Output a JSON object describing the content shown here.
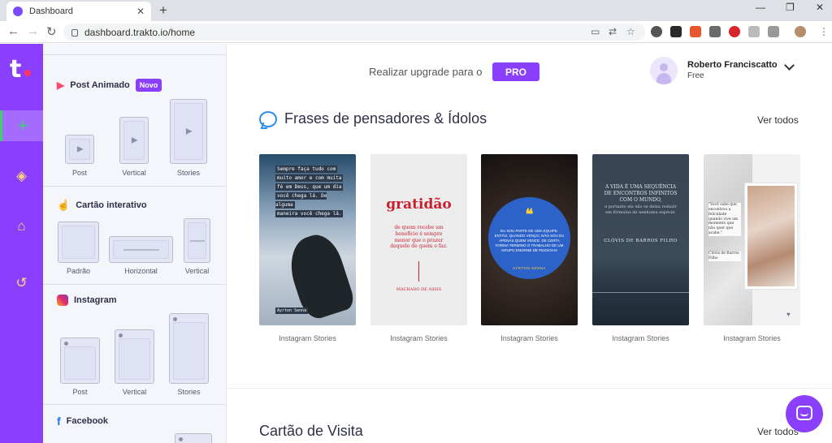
{
  "browser": {
    "tab_title": "Dashboard",
    "url": "dashboard.trakto.io/home",
    "win_min": "—",
    "win_max": "❐",
    "win_close": "✕"
  },
  "rail": {
    "logo": "t",
    "items": [
      {
        "name": "create",
        "icon": "+"
      },
      {
        "name": "layers",
        "icon": "layers-icon"
      },
      {
        "name": "bank",
        "icon": "bank-icon"
      },
      {
        "name": "history",
        "icon": "history-icon"
      }
    ]
  },
  "panel": {
    "sections": [
      {
        "title": "Post Animado",
        "badge": "Novo",
        "formats": [
          "Post",
          "Vertical",
          "Stories"
        ]
      },
      {
        "title": "Cartão interativo",
        "formats": [
          "Padrão",
          "Horizontal",
          "Vertical"
        ]
      },
      {
        "title": "Instagram",
        "formats": [
          "Post",
          "Vertical",
          "Stories"
        ]
      },
      {
        "title": "Facebook"
      }
    ]
  },
  "header": {
    "upgrade_text": "Realizar upgrade para o",
    "pro_label": "PRO",
    "user_name": "Roberto Franciscatto",
    "user_plan": "Free"
  },
  "sections": {
    "quotes": {
      "title": "Frases de pensadores & Ídolos",
      "see_all": "Ver todos",
      "cards": [
        {
          "label": "Instagram Stories",
          "quote_lines": [
            "Sempre faça tudo com",
            "muito amor e com muita",
            "fé em Deus, que um dia",
            "você chega lá. De alguma",
            "maneira você chega lá."
          ],
          "author": "Ayrton Senna"
        },
        {
          "label": "Instagram Stories",
          "big": "gratidão",
          "small": "de quem recebe um benefício é sempre menor que o prazer daquele de quem o faz.",
          "author": "MACHADO DE ASSIS"
        },
        {
          "label": "Instagram Stories",
          "mark": "❝",
          "text": "EU SOU PARTE DE UMA EQUIPE. ENTÃO, QUANDO VENÇO, NÃO SOU EU APENAS QUEM VENCE. DE CERTA FORMA TERMINO O TRABALHO DE UM GRUPO ENORME DE PESSOAS!",
          "author": "AYRTON SENNA"
        },
        {
          "label": "Instagram Stories",
          "line1": "A VIDA É UMA SEQUÊNCIA DE ENCONTROS INFINITOS COM O MUNDO,",
          "line2": "e portanto ela não se deixa reduzir em fórmulas de nenhuma espécie.",
          "author": "CLÓVIS DE BARROS FILHO"
        },
        {
          "label": "Instagram Stories",
          "quote": "\"Você sabe que encontrou a felicidade quando vive um momento que não quer que acabe.\"",
          "author": "Clóvis de Barros Filho"
        }
      ]
    },
    "business_card": {
      "title": "Cartão de Visita",
      "see_all": "Ver todos"
    }
  },
  "colors": {
    "brand": "#8a3ffc",
    "rail_active": "#3bd16f",
    "link_blue": "#2d8cf0"
  }
}
